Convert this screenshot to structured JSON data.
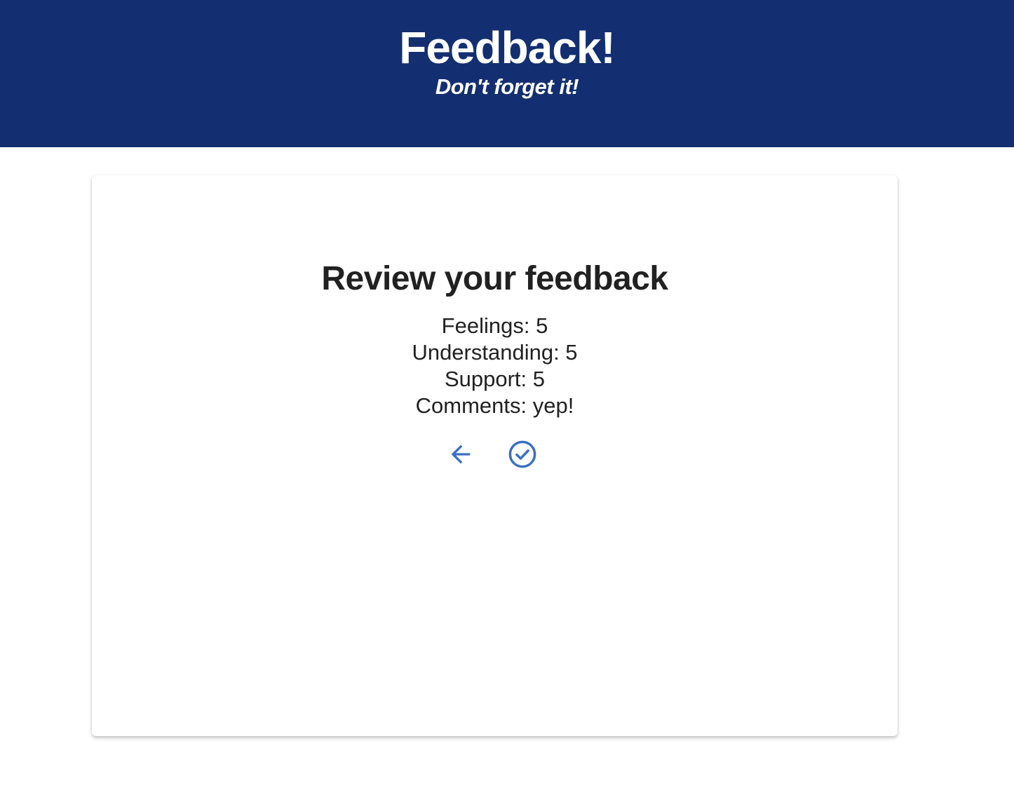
{
  "header": {
    "title": "Feedback!",
    "subtitle": "Don't forget it!",
    "background_color": "#132f71"
  },
  "review": {
    "heading": "Review your feedback",
    "items": [
      {
        "label": "Feelings",
        "value": "5",
        "text": "Feelings: 5"
      },
      {
        "label": "Understanding",
        "value": "5",
        "text": "Understanding: 5"
      },
      {
        "label": "Support",
        "value": "5",
        "text": "Support: 5"
      },
      {
        "label": "Comments",
        "value": "yep!",
        "text": "Comments: yep!"
      }
    ],
    "actions": {
      "back_icon": "arrow-left-icon",
      "submit_icon": "check-circle-icon",
      "icon_color": "#3a6fc4"
    }
  }
}
